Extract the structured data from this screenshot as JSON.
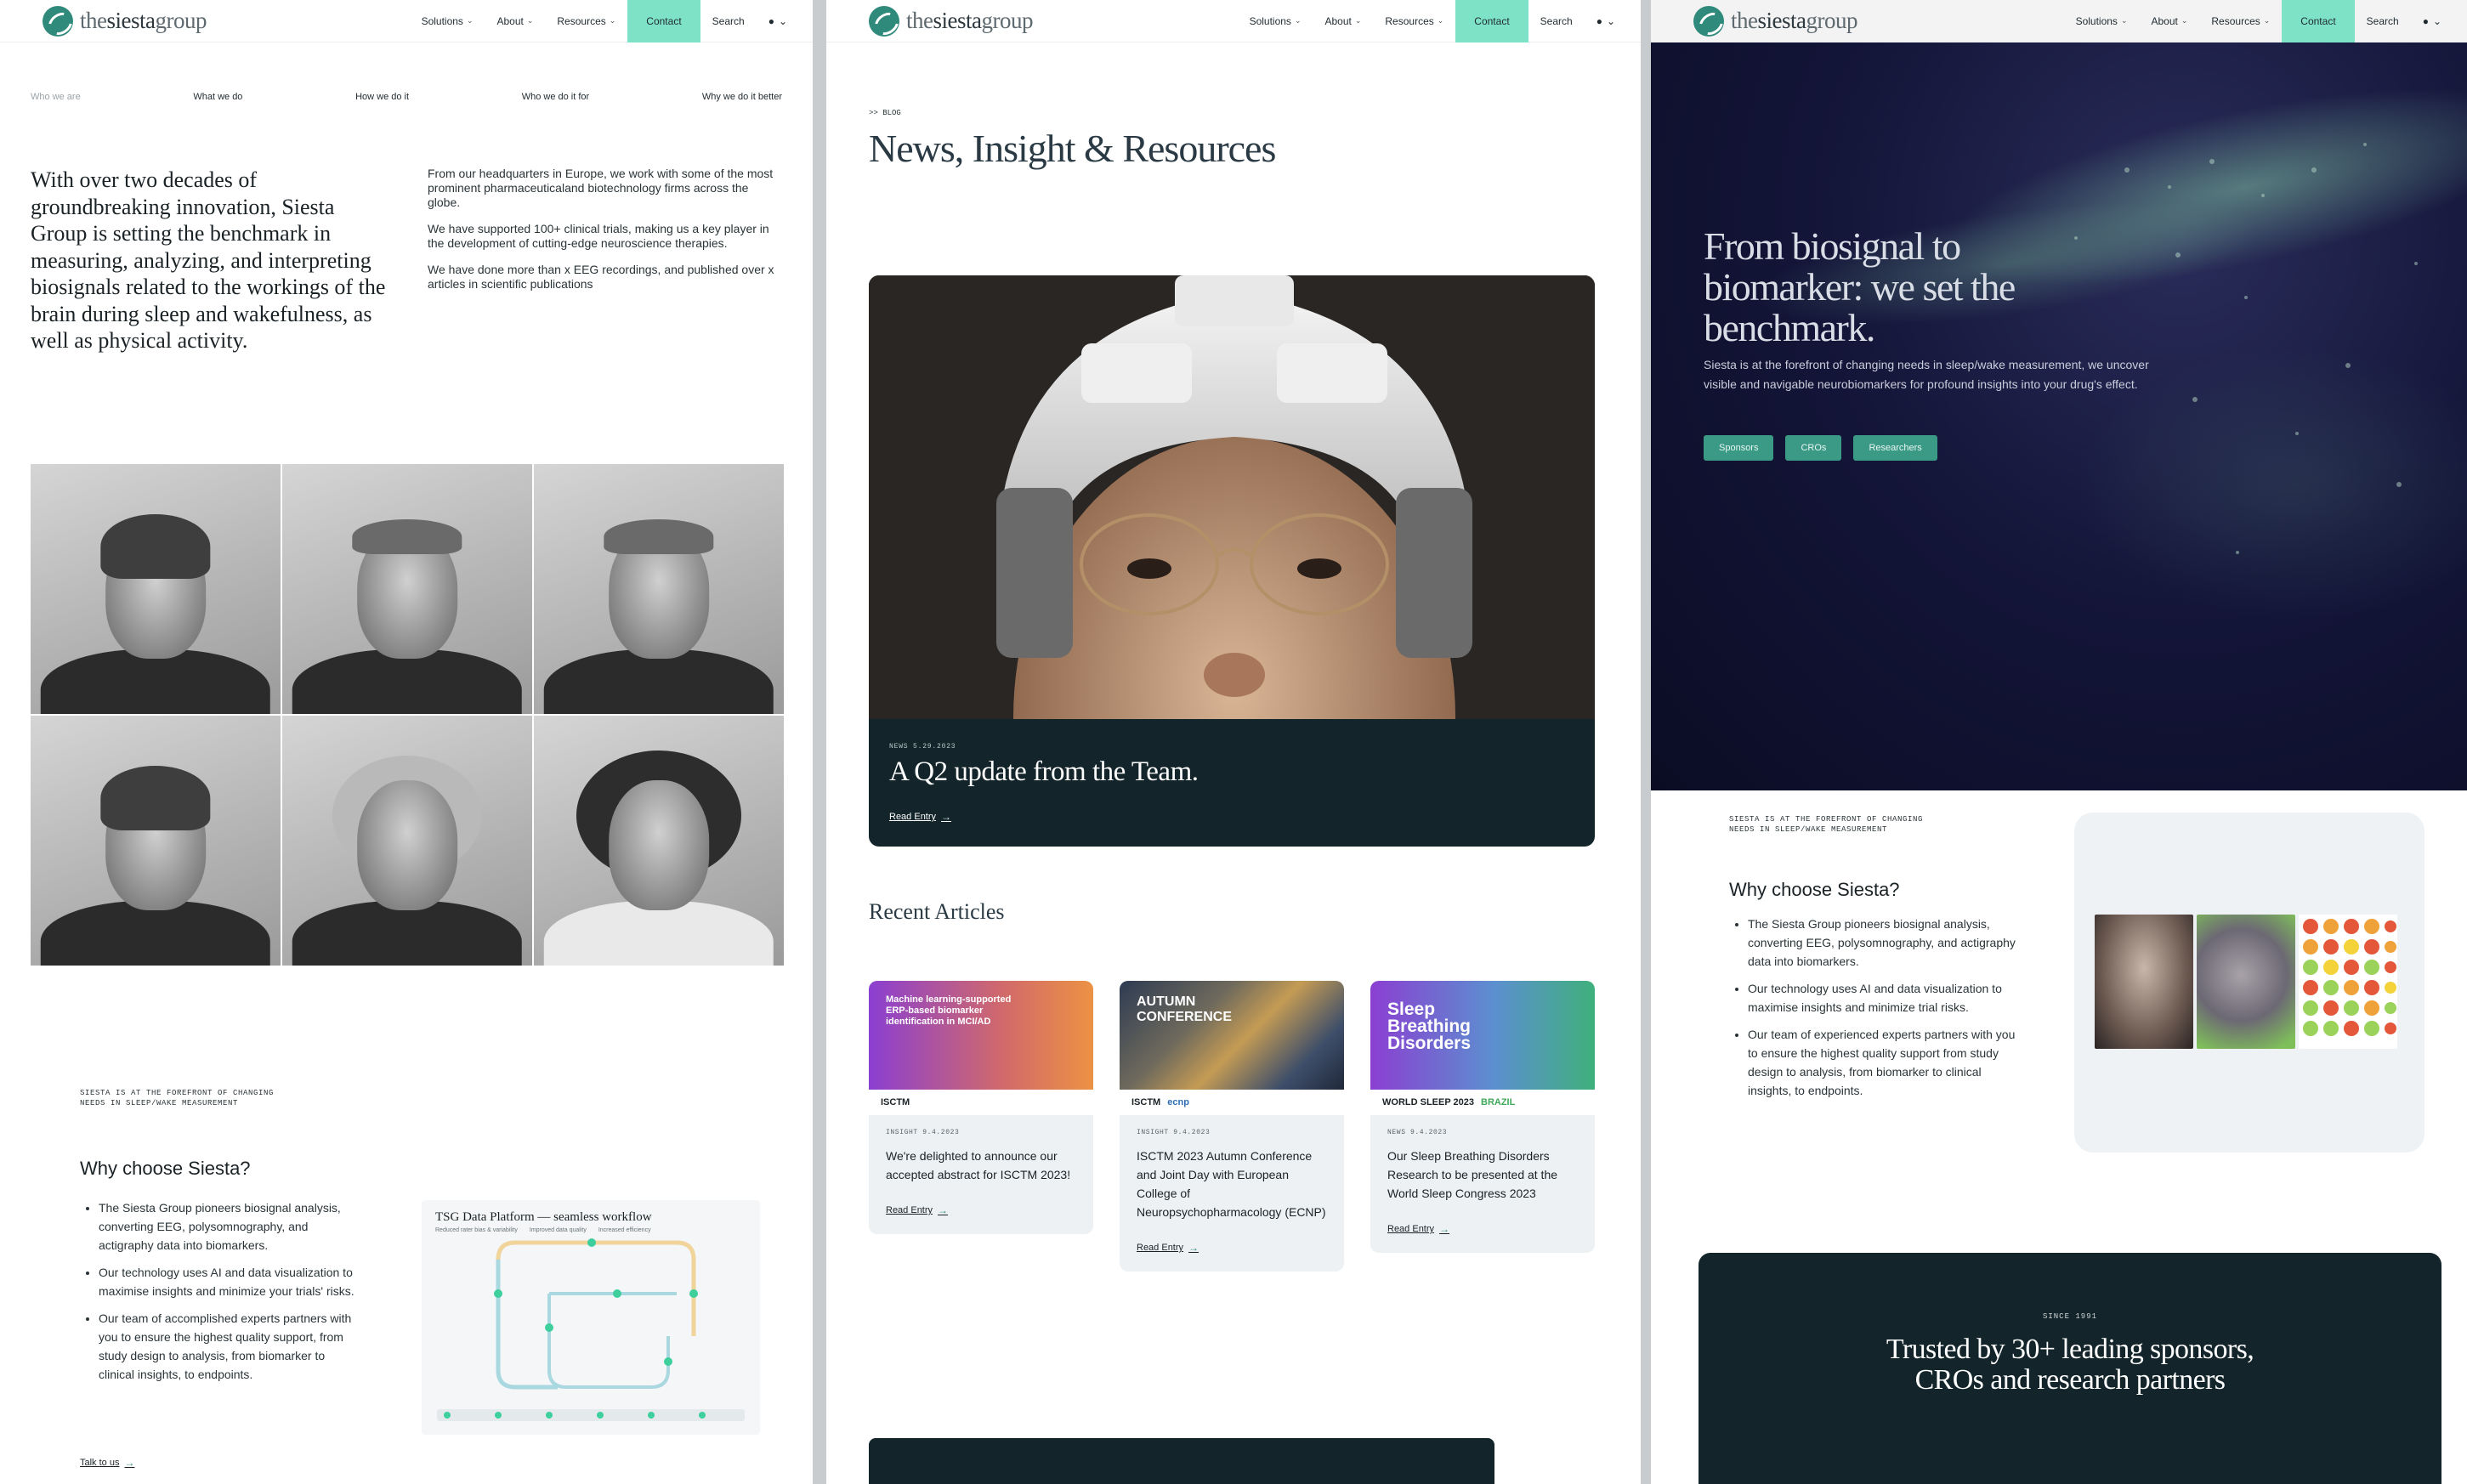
{
  "nav": {
    "logo_the": "the",
    "logo_siesta": "siesta",
    "logo_group": "group",
    "items": [
      {
        "label": "Solutions"
      },
      {
        "label": "About"
      },
      {
        "label": "Resources"
      }
    ],
    "contact": "Contact",
    "search": "Search",
    "lang_glyph": "●"
  },
  "about": {
    "subnav": [
      "Who we are",
      "What we do",
      "How we do it",
      "Who we do it for",
      "Why we do it better"
    ],
    "intro": "With over two decades of groundbreaking innovation, Siesta Group is setting the benchmark in measuring, analyzing, and interpreting biosignals related to the workings of the brain during sleep and wakefulness, as well as physical activity.",
    "side": [
      "From our headquarters in Europe, we work with some of the most prominent pharmaceuticaland biotechnology firms across the globe.",
      "We have supported 100+ clinical trials, making us a key player in the development of cutting-edge neuroscience therapies.",
      "We have done more than x EEG recordings, and published over x articles in scientific publications"
    ],
    "eyebrow": "SIESTA IS AT THE FOREFRONT OF CHANGING NEEDS IN SLEEP/WAKE MEASUREMENT",
    "why_title": "Why choose Siesta?",
    "bullets": [
      "The Siesta Group pioneers biosignal analysis, converting EEG, polysomnography, and actigraphy data into biomarkers.",
      "Our technology uses AI and data visualization to maximise insights and minimize your trials' risks.",
      "Our team of accomplished experts partners with you to ensure the highest quality support, from study design to analysis, from biomarker to clinical insights, to endpoints."
    ],
    "talk": "Talk to us",
    "workflow_title": "TSG Data Platform — seamless workflow",
    "workflow_legend": [
      "Reduced rater bias & variability",
      "Improved data quality",
      "Increased efficiency"
    ]
  },
  "blog": {
    "eyebrow": ">> BLOG",
    "title": "News, Insight & Resources",
    "hero": {
      "meta": "NEWS  5.29.2023",
      "title": "A Q2 update from the Team.",
      "read": "Read Entry"
    },
    "recent_title": "Recent Articles",
    "articles": [
      {
        "thumb": "Machine learning-supported ERP-based biomarker identification in MCI/AD",
        "logo1": "ISCTM",
        "logo2": "",
        "meta": "INSIGHT  9.4.2023",
        "title": "We're delighted to announce our accepted abstract for ISCTM 2023!",
        "read": "Read Entry"
      },
      {
        "thumb": "AUTUMN CONFERENCE",
        "logo1": "ISCTM",
        "logo2": "ecnp",
        "meta": "INSIGHT  9.4.2023",
        "title": "ISCTM 2023 Autumn Conference and Joint Day with European College of Neuropsychopharmacology (ECNP)",
        "read": "Read Entry"
      },
      {
        "thumb": "Sleep Breathing Disorders",
        "logo1": "WORLD SLEEP 2023",
        "logo2": "BRAZIL",
        "meta": "NEWS  9.4.2023",
        "title": "Our Sleep Breathing Disorders Research to be presented at the World Sleep Congress 2023",
        "read": "Read Entry"
      }
    ]
  },
  "home": {
    "hero_title": "From biosignal to biomarker: we set the benchmark.",
    "hero_text": "Siesta is at the forefront of changing needs in sleep/wake measurement, we uncover visible and navigable neurobiomarkers for profound insights into your drug's effect.",
    "buttons": [
      "Sponsors",
      "CROs",
      "Researchers"
    ],
    "eyebrow": "SIESTA IS AT THE FOREFRONT OF CHANGING NEEDS IN SLEEP/WAKE MEASUREMENT",
    "why_title": "Why choose Siesta?",
    "bullets": [
      "The Siesta Group pioneers biosignal analysis, converting EEG, polysomnography, and actigraphy data into biomarkers.",
      "Our technology uses AI and data visualization to maximise insights and minimize trial risks.",
      "Our team of experienced experts partners with you to ensure the highest quality support from study design to analysis, from biomarker to clinical insights, to endpoints."
    ],
    "since": "SINCE 1991",
    "trusted": "Trusted by 30+ leading sponsors, CROs and research partners"
  }
}
